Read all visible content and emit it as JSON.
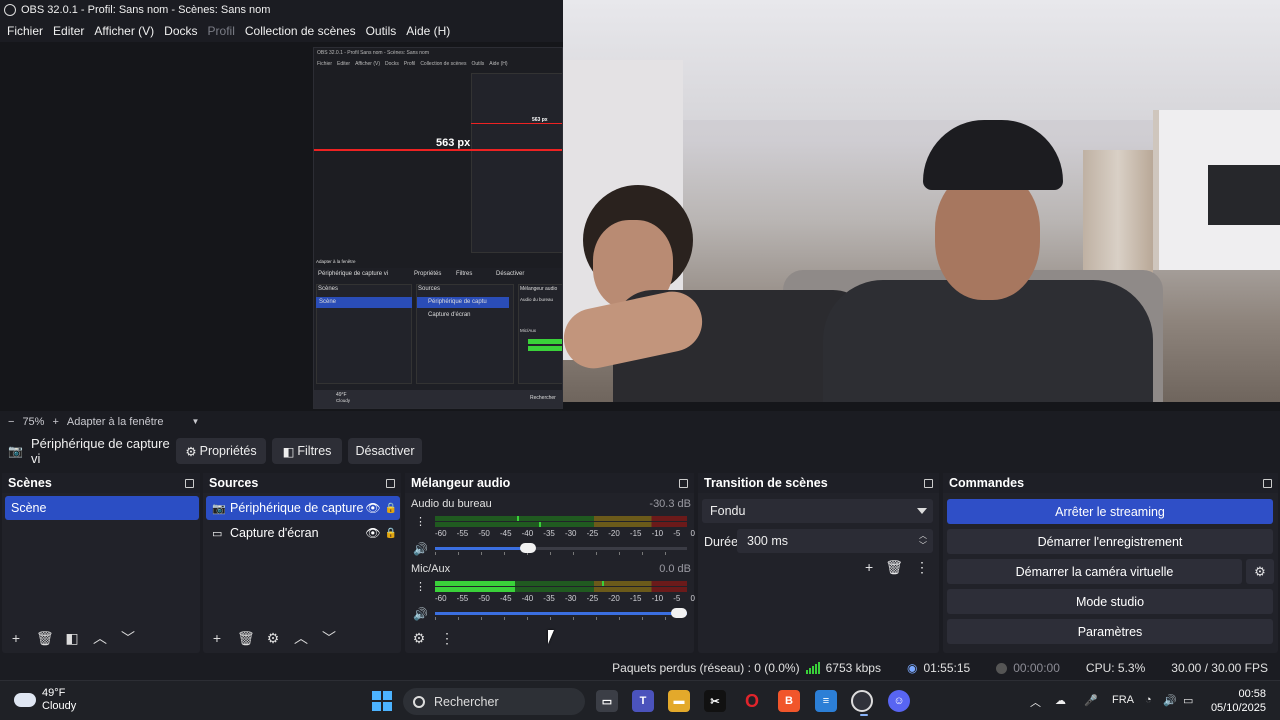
{
  "window": {
    "title": "OBS 32.0.1 - Profil: Sans nom - Scènes: Sans nom"
  },
  "menu": [
    {
      "label": "Fichier",
      "disabled": false
    },
    {
      "label": "Editer",
      "disabled": false
    },
    {
      "label": "Afficher (V)",
      "disabled": false
    },
    {
      "label": "Docks",
      "disabled": false
    },
    {
      "label": "Profil",
      "disabled": true
    },
    {
      "label": "Collection de scènes",
      "disabled": false
    },
    {
      "label": "Outils",
      "disabled": false
    },
    {
      "label": "Aide (H)",
      "disabled": false
    }
  ],
  "preview": {
    "nested_title": "OBS 32.0.1 - Profil Sans nom - Scènes: Sans nom",
    "nested_menu": [
      "Fichier",
      "Editer",
      "Afficher (V)",
      "Docks",
      "Profil",
      "Collection de scènes",
      "Outils",
      "Aide (H)"
    ],
    "measure_label": "563 px",
    "measure_label_small": "563 px",
    "nested_source": "Périphérique de capture vi",
    "nested_props": "Propriétés",
    "nested_filters": "Filtres",
    "nested_disable": "Désactiver",
    "nested_scenes": "Scènes",
    "nested_scene_item": "Scène",
    "nested_sources": "Sources",
    "nested_source_1": "Périphérique de captu",
    "nested_source_2": "Capture d'écran",
    "nested_mixer": "Mélangeur audio",
    "nested_ch1": "Audio du bureau",
    "nested_ch2": "Mic/Aux",
    "nested_weather_temp": "49°F",
    "nested_weather_desc": "Cloudy",
    "nested_search": "Rechercher",
    "nested_zoom": "Adapter à la fenêtre"
  },
  "zoom": {
    "minus": "−",
    "value": "75%",
    "plus": "+",
    "fit_label": "Adapter à la fenêtre"
  },
  "context": {
    "source_label": "Périphérique de capture vi",
    "properties": "Propriétés",
    "filters": "Filtres",
    "disable": "Désactiver"
  },
  "scenes": {
    "title": "Scènes",
    "items": [
      "Scène"
    ],
    "selected": 0
  },
  "sources": {
    "title": "Sources",
    "items": [
      {
        "label": "Périphérique de capture",
        "icon": "camera-icon",
        "selected": true
      },
      {
        "label": "Capture d'écran",
        "icon": "monitor-icon",
        "selected": false
      }
    ]
  },
  "mixer": {
    "title": "Mélangeur audio",
    "channels": [
      {
        "name": "Audio du bureau",
        "db": "-30.3 dB",
        "level_db": -30.3,
        "volume": 0.37
      },
      {
        "name": "Mic/Aux",
        "db": "0.0 dB",
        "level_db": 0.0,
        "volume": 1.0
      }
    ],
    "scale": [
      "-60",
      "-55",
      "-50",
      "-45",
      "-40",
      "-35",
      "-30",
      "-25",
      "-20",
      "-15",
      "-10",
      "-5",
      "0"
    ]
  },
  "transitions": {
    "title": "Transition de scènes",
    "selected": "Fondu",
    "duration_label": "Durée",
    "duration_value": "300 ms"
  },
  "controls": {
    "title": "Commandes",
    "stop_streaming": "Arrêter le streaming",
    "start_recording": "Démarrer l'enregistrement",
    "start_virtual_cam": "Démarrer la caméra virtuelle",
    "studio_mode": "Mode studio",
    "settings": "Paramètres"
  },
  "status": {
    "dropped": "Paquets perdus (réseau) : 0 (0.0%)",
    "bitrate": "6753 kbps",
    "stream_time": "01:55:15",
    "rec_time": "00:00:00",
    "cpu": "CPU: 5.3%",
    "fps": "30.00 / 30.00 FPS"
  },
  "taskbar": {
    "weather_temp": "49°F",
    "weather_desc": "Cloudy",
    "search_placeholder": "Rechercher",
    "language": "FRA",
    "time": "00:58",
    "date": "05/10/2025"
  },
  "colors": {
    "accent": "#2b4ec4",
    "meter_green": "#3ad13a",
    "bg": "#1b1c22",
    "dock": "#212229"
  }
}
